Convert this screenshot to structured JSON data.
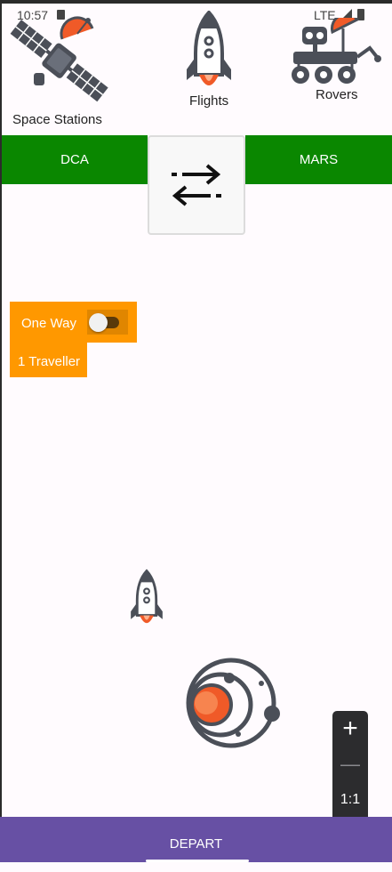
{
  "status_bar": {
    "time": "10:57",
    "network": "LTE"
  },
  "categories": [
    {
      "label": "Space Stations",
      "icon": "satellite-icon"
    },
    {
      "label": "Flights",
      "icon": "rocket-icon"
    },
    {
      "label": "Rovers",
      "icon": "rover-icon"
    }
  ],
  "route": {
    "origin": "DCA",
    "destination": "MARS",
    "swap_icon": "swap-arrows-icon"
  },
  "options": {
    "trip_type_label": "One Way",
    "one_way_enabled": false,
    "travellers_label": "1 Traveller"
  },
  "map": {
    "zoom_in": "+",
    "zoom_out": "—",
    "zoom_reset": "1:1",
    "fit_icon": "fit-screen-icon"
  },
  "action": {
    "depart_label": "DEPART"
  },
  "colors": {
    "route_bar": "#0a8700",
    "options": "#ff9800",
    "depart_bar": "#6750a4",
    "icon_gray": "#4b4f58",
    "flame": "#f05a28"
  }
}
